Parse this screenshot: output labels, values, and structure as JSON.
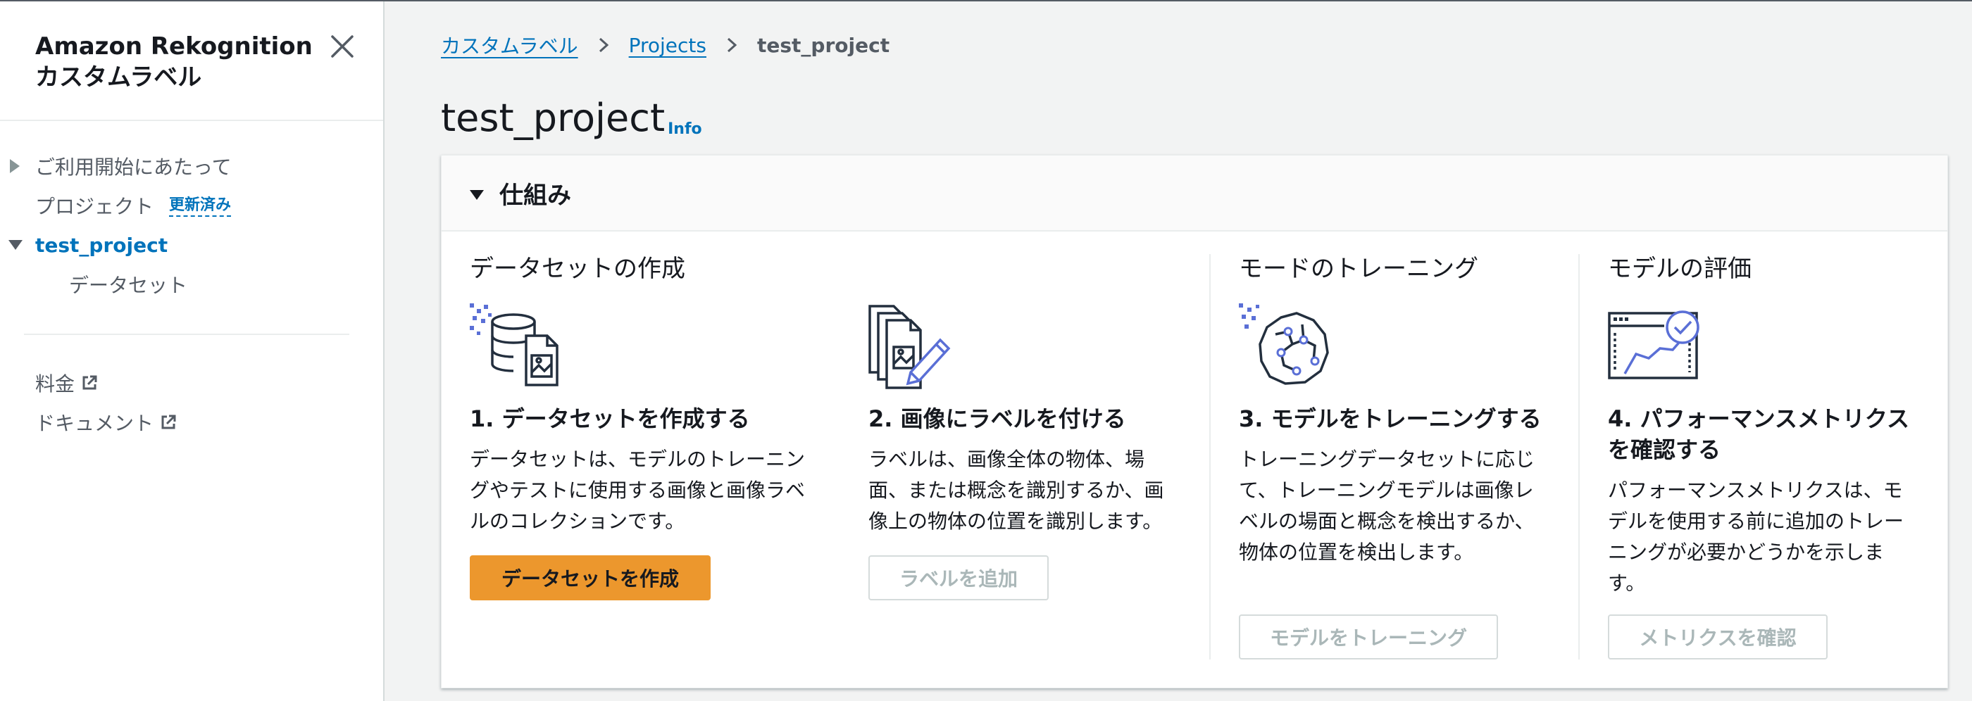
{
  "sidebar": {
    "title_line1": "Amazon Rekognition",
    "title_line2": "カスタムラベル",
    "nav": {
      "getting_started": "ご利用開始にあたって",
      "projects": "プロジェクト",
      "projects_badge": "更新済み",
      "current_project": "test_project",
      "datasets": "データセット"
    },
    "links": {
      "pricing": "料金",
      "documentation": "ドキュメント"
    }
  },
  "breadcrumb": {
    "root": "カスタムラベル",
    "projects": "Projects",
    "current": "test_project"
  },
  "page": {
    "title": "test_project",
    "info": "Info"
  },
  "how_it_works": {
    "title": "仕組み",
    "sections": {
      "dataset": "データセットの作成",
      "training": "モードのトレーニング",
      "evaluation": "モデルの評価"
    },
    "steps": [
      {
        "title": "1. データセットを作成する",
        "desc_lines": [
          "データセットは、モデルのトレーニン",
          "グやテストに使用する画像と画像ラベ",
          "ルのコレクションです。"
        ],
        "button": "データセットを作成",
        "button_state": "primary"
      },
      {
        "title": "2. 画像にラベルを付ける",
        "desc_lines": [
          "ラベルは、画像全体の物体、場",
          "面、または概念を識別するか、画",
          "像上の物体の位置を識別します。"
        ],
        "button": "ラベルを追加",
        "button_state": "disabled"
      },
      {
        "title": "3. モデルをトレーニングする",
        "desc_lines": [
          "トレーニングデータセットに応じ",
          "て、トレーニングモデルは画像レ",
          "ベルの場面と概念を検出するか、",
          "物体の位置を検出します。"
        ],
        "button": "モデルをトレーニング",
        "button_state": "disabled"
      },
      {
        "title_lines": [
          "4. パフォーマンスメトリクス",
          "を確認する"
        ],
        "desc_lines": [
          "パフォーマンスメトリクスは、モ",
          "デルを使用する前に追加のトレー",
          "ニングが必要かどうかを示しま",
          "す。"
        ],
        "button": "メトリクスを確認",
        "button_state": "disabled"
      }
    ]
  },
  "colors": {
    "primary_button": "#ec972d",
    "link": "#0073bb",
    "icon_accent": "#5a6fd6",
    "background": "#f2f3f3"
  },
  "icons": [
    "close-icon",
    "caret-right-icon",
    "caret-down-icon",
    "external-link-icon",
    "chevron-right-icon",
    "database-image-icon",
    "labeling-pencil-icon",
    "brain-network-icon",
    "metrics-chart-icon"
  ]
}
